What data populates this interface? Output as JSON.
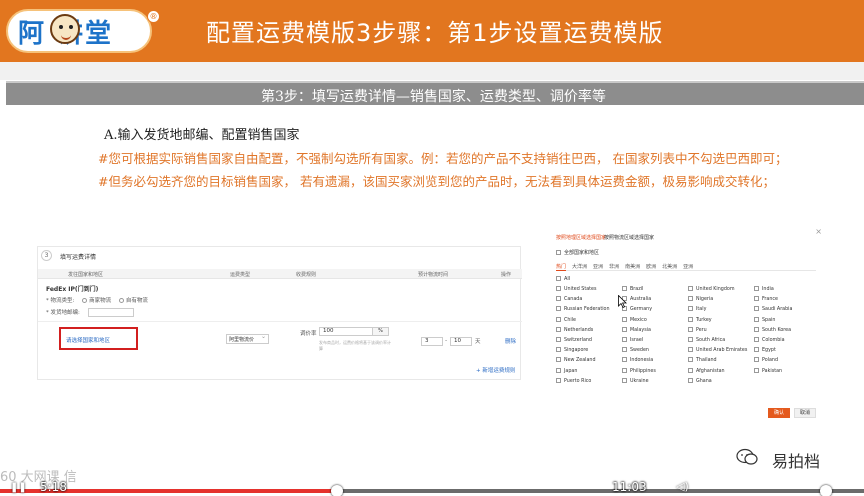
{
  "banner": {
    "logo_text": "阿 讲堂",
    "logo_reg": "®",
    "title": "配置运费模版3步骤：第1步设置运费模版",
    "bg_color": "#e2761f"
  },
  "subtitle": "第3步：填写运费详情—销售国家、运费类型、调价率等",
  "section_a": "A.输入发货地邮编、配置销售国家",
  "notes": [
    "#您可根据实际销售国家自由配置，不强制勾选所有国家。例：若您的产品不支持销往巴西， 在国家列表中不勾选巴西即可；",
    "#但务必勾选齐您的目标销售国家， 若有遗漏，该国买家浏览到您的产品时，无法看到具体运费金额，极易影响成交转化；"
  ],
  "note_color": "#e0762a",
  "form": {
    "step_no": "3",
    "title": "填写运费详情",
    "headers": [
      "发往国家和地区",
      "运费类型",
      "收费规则",
      "预计物流时间",
      "操作"
    ],
    "carrier": "FedEx IP(门到门)",
    "logistics_label": "* 物流类型:",
    "logistics_options": [
      "商家物流",
      "自有物流"
    ],
    "zip_label": "* 发货地邮编:",
    "select_link": "请选择国家和地区",
    "freight_type": "阿里物流价",
    "rate_label": "调价率",
    "rate_value": "100",
    "rate_unit": "%",
    "rate_help": "发布商品时，运费价格将基于该调价率计算",
    "time_from": "3",
    "time_dash": "-",
    "time_to": "10",
    "time_unit": "天",
    "op_link": "删除",
    "add_link": "+ 新增运费规则"
  },
  "dialog": {
    "close": "×",
    "tab_active": "按照地理区域选择国家",
    "tab_other": "按照物流区域选择国家",
    "select_all_label": "全部国家和地区",
    "regions": [
      "热门",
      "大洋洲",
      "亚洲",
      "非洲",
      "南美洲",
      "欧洲",
      "北美洲",
      "亚洲"
    ],
    "all_label": "All",
    "countries": [
      [
        "United States",
        "Brazil",
        "United Kingdom",
        "India"
      ],
      [
        "Canada",
        "Australia",
        "Nigeria",
        "France"
      ],
      [
        "Russian Federation",
        "Germany",
        "Italy",
        "Saudi Arabia"
      ],
      [
        "Chile",
        "Mexico",
        "Turkey",
        "Spain"
      ],
      [
        "Netherlands",
        "Malaysia",
        "Peru",
        "South Korea"
      ],
      [
        "Switzerland",
        "Israel",
        "South Africa",
        "Colombia"
      ],
      [
        "Singapore",
        "Sweden",
        "United Arab Emirates",
        "Egypt"
      ],
      [
        "New Zealand",
        "Indonesia",
        "Thailand",
        "Poland"
      ],
      [
        "Japan",
        "Philippines",
        "Afghanistan",
        "Pakistan"
      ],
      [
        "Puerto Rico",
        "Ukraine",
        "Ghana",
        ""
      ]
    ],
    "ok_label": "确认",
    "cancel_label": "取消",
    "accent_color": "#e45a1e"
  },
  "watermark_left": "60 大网课 信",
  "watermark_right": "易拍档",
  "player": {
    "current_time": "5:18",
    "end_time": "11:03",
    "progress": 0.39
  }
}
